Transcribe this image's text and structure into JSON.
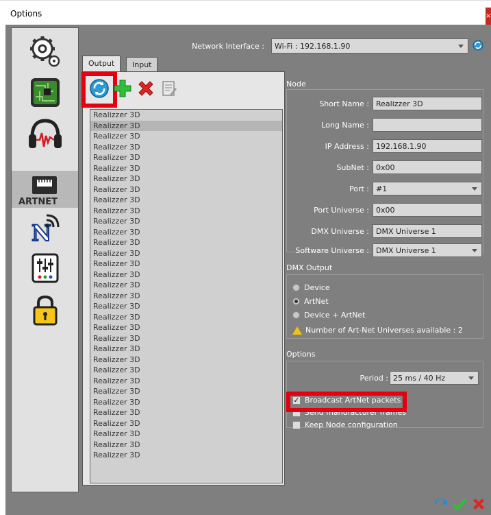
{
  "window": {
    "title": "Options",
    "close_glyph": "×"
  },
  "sidebar": {
    "items": [
      {
        "icon": "gears-icon"
      },
      {
        "icon": "circuit-board-icon"
      },
      {
        "icon": "headphones-icon"
      },
      {
        "icon": "artnet-icon",
        "label": "ARTNET",
        "active": true
      },
      {
        "icon": "wireless-n-icon"
      },
      {
        "icon": "mixer-icon"
      },
      {
        "icon": "padlock-icon"
      }
    ]
  },
  "network": {
    "label": "Network Interface :",
    "value": "Wi-Fi : 192.168.1.90"
  },
  "tabs": [
    {
      "label": "Output",
      "active": true
    },
    {
      "label": "Input",
      "active": false
    }
  ],
  "toolbar": {
    "refresh": "refresh-icon",
    "add": "add-icon",
    "delete": "delete-icon",
    "edit": "edit-icon"
  },
  "nodes": {
    "items": [
      "Realizzer 3D",
      "Realizzer 3D",
      "Realizzer 3D",
      "Realizzer 3D",
      "Realizzer 3D",
      "Realizzer 3D",
      "Realizzer 3D",
      "Realizzer 3D",
      "Realizzer 3D",
      "Realizzer 3D",
      "Realizzer 3D",
      "Realizzer 3D",
      "Realizzer 3D",
      "Realizzer 3D",
      "Realizzer 3D",
      "Realizzer 3D",
      "Realizzer 3D",
      "Realizzer 3D",
      "Realizzer 3D",
      "Realizzer 3D",
      "Realizzer 3D",
      "Realizzer 3D",
      "Realizzer 3D",
      "Realizzer 3D",
      "Realizzer 3D",
      "Realizzer 3D",
      "Realizzer 3D",
      "Realizzer 3D",
      "Realizzer 3D",
      "Realizzer 3D",
      "Realizzer 3D",
      "Realizzer 3D",
      "Realizzer 3D"
    ]
  },
  "node": {
    "title": "Node",
    "short_name_label": "Short Name :",
    "short_name": "Realizzer 3D",
    "long_name_label": "Long Name :",
    "long_name": "",
    "ip_label": "IP Address :",
    "ip": "192.168.1.90",
    "subnet_label": "SubNet :",
    "subnet": "0x00",
    "port_label": "Port :",
    "port": "#1",
    "port_universe_label": "Port Universe :",
    "port_universe": "0x00",
    "dmx_universe_label": "DMX Universe :",
    "dmx_universe": "DMX Universe 1",
    "software_universe_label": "Software Universe :",
    "software_universe": "DMX Universe 1"
  },
  "dmx_output": {
    "title": "DMX Output",
    "options": [
      {
        "label": "Device",
        "selected": false
      },
      {
        "label": "ArtNet",
        "selected": true
      },
      {
        "label": "Device + ArtNet",
        "selected": false
      }
    ],
    "warning": "Number of Art-Net Universes available : 2"
  },
  "options": {
    "title": "Options",
    "period_label": "Period :",
    "period": "25 ms / 40 Hz",
    "broadcast_label": "Broadcast ArtNet packets",
    "broadcast_checked": true,
    "send_mfr_label": "Send manufacturer frames",
    "send_mfr_checked": false,
    "keep_label": "Keep Node configuration",
    "keep_checked": false
  },
  "footer": {
    "icons": [
      "apply-icon",
      "ok-check-icon",
      "cancel-x-icon"
    ]
  },
  "colors": {
    "highlight": "#e3000f",
    "panel_bg": "#7f7f7f",
    "sidebar_bg": "#e1e1e1"
  }
}
